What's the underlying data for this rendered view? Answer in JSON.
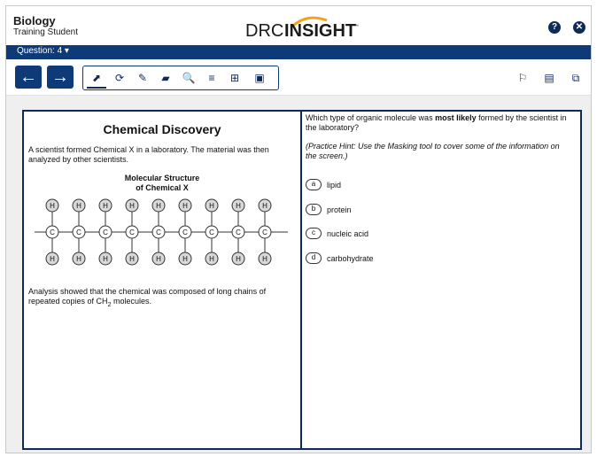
{
  "header": {
    "subject": "Biology",
    "student": "Training Student",
    "logo_left": "DRC",
    "logo_right": "INSIGHT",
    "logo_tm": "™",
    "help_icon": "help-icon",
    "close_icon": "close-icon"
  },
  "qbar": {
    "label": "Question: 4 ▾"
  },
  "toolbar": {
    "back_glyph": "←",
    "forward_glyph": "→",
    "tools": [
      {
        "name": "pointer-icon",
        "glyph": "⬈"
      },
      {
        "name": "refresh-icon",
        "glyph": "⟳"
      },
      {
        "name": "highlighter-icon",
        "glyph": "✎"
      },
      {
        "name": "sticky-note-icon",
        "glyph": "▰"
      },
      {
        "name": "magnifier-icon",
        "glyph": "🔍"
      },
      {
        "name": "line-reader-icon",
        "glyph": "≡"
      },
      {
        "name": "grid-icon",
        "glyph": "⊞"
      },
      {
        "name": "masking-icon",
        "glyph": "▣"
      }
    ],
    "right_tools": [
      {
        "name": "flag-icon",
        "glyph": "⚐"
      },
      {
        "name": "notepad-icon",
        "glyph": "▤"
      },
      {
        "name": "review-icon",
        "glyph": "⧉"
      }
    ]
  },
  "passage": {
    "title": "Chemical Discovery",
    "intro": "A scientist formed Chemical X in a laboratory. The material was then analyzed by other scientists.",
    "structure_title_line1": "Molecular Structure",
    "structure_title_line2": "of Chemical X",
    "atom_h": "H",
    "atom_c": "C",
    "analysis_pre": "Analysis showed that the chemical was composed of long chains of repeated copies of CH",
    "analysis_sub": "2",
    "analysis_post": " molecules."
  },
  "question": {
    "stem_pre": "Which type of organic molecule was ",
    "stem_bold": "most likely",
    "stem_post": " formed by the scientist in the laboratory?",
    "hint": "(Practice Hint: Use the Masking tool to cover some of the information on the screen.)",
    "options": [
      {
        "letter": "a",
        "text": "lipid"
      },
      {
        "letter": "b",
        "text": "protein"
      },
      {
        "letter": "c",
        "text": "nucleic acid"
      },
      {
        "letter": "d",
        "text": "carbohydrate"
      }
    ]
  },
  "colors": {
    "navy": "#0e3a78",
    "dark_navy": "#0e2a56",
    "logo_orange": "#f7a01b"
  }
}
